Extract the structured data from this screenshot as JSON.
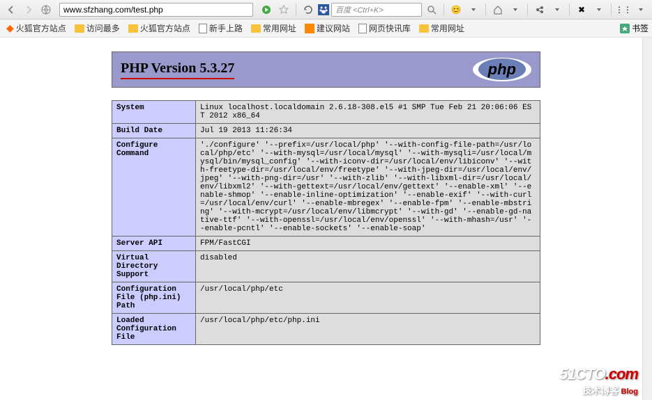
{
  "nav": {
    "url": "www.sfzhang.com/test.php",
    "search_placeholder": "百度 <Ctrl+K>"
  },
  "bookmarks": {
    "items": [
      {
        "label": "火狐官方站点",
        "type": "fire"
      },
      {
        "label": "访问最多",
        "type": "folder"
      },
      {
        "label": "火狐官方站点",
        "type": "folder"
      },
      {
        "label": "新手上路",
        "type": "page"
      },
      {
        "label": "常用网址",
        "type": "folder"
      },
      {
        "label": "建议网站",
        "type": "orange"
      },
      {
        "label": "网页快讯库",
        "type": "page"
      },
      {
        "label": "常用网址",
        "type": "folder"
      }
    ],
    "right_label": "书签"
  },
  "php": {
    "title": "PHP Version 5.3.27",
    "logo": "php",
    "rows": [
      {
        "key": "System",
        "val": "Linux localhost.localdomain 2.6.18-308.el5 #1 SMP Tue Feb 21 20:06:06 EST 2012 x86_64"
      },
      {
        "key": "Build Date",
        "val": "Jul 19 2013 11:26:34"
      },
      {
        "key": "Configure Command",
        "val": "'./configure' '--prefix=/usr/local/php' '--with-config-file-path=/usr/local/php/etc' '--with-mysql=/usr/local/mysql' '--with-mysqli=/usr/local/mysql/bin/mysql_config' '--with-iconv-dir=/usr/local/env/libiconv' '--with-freetype-dir=/usr/local/env/freetype' '--with-jpeg-dir=/usr/local/env/jpeg' '--with-png-dir=/usr' '--with-zlib' '--with-libxml-dir=/usr/local/env/libxml2' '--with-gettext=/usr/local/env/gettext' '--enable-xml' '--enable-shmop' '--enable-inline-optimization' '--enable-exif' '--with-curl=/usr/local/env/curl' '--enable-mbregex' '--enable-fpm' '--enable-mbstring' '--with-mcrypt=/usr/local/env/libmcrypt' '--with-gd' '--enable-gd-native-ttf' '--with-openssl=/usr/local/env/openssl' '--with-mhash=/usr' '--enable-pcntl' '--enable-sockets' '--enable-soap'"
      },
      {
        "key": "Server API",
        "val": "FPM/FastCGI"
      },
      {
        "key": "Virtual Directory Support",
        "val": "disabled"
      },
      {
        "key": "Configuration File (php.ini) Path",
        "val": "/usr/local/php/etc"
      },
      {
        "key": "Loaded Configuration File",
        "val": "/usr/local/php/etc/php.ini"
      }
    ]
  },
  "watermark": {
    "top_a": "51CTO",
    "top_b": ".com",
    "sub": "技术博客",
    "blog": "Blog"
  }
}
